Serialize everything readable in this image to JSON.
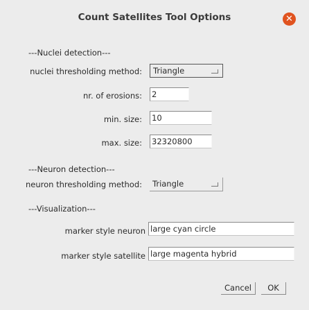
{
  "window": {
    "title": "Count Satellites Tool Options",
    "close_icon": "close-icon",
    "close_glyph": "✕",
    "accent": "#e0531f"
  },
  "nuclei": {
    "header": "---Nuclei detection---",
    "threshold_label": "nuclei thresholding method:",
    "threshold_value": "Triangle",
    "erosions_label": "nr. of erosions:",
    "erosions_value": "2",
    "min_size_label": "min. size:",
    "min_size_value": "10",
    "max_size_label": "max. size:",
    "max_size_value": "32320800"
  },
  "neuron": {
    "header": "---Neuron detection---",
    "threshold_label": "neuron thresholding method:",
    "threshold_value": "Triangle"
  },
  "visualization": {
    "header": "---Visualization---",
    "marker_neuron_label": "marker style neuron",
    "marker_neuron_value": "large cyan circle",
    "marker_satellite_label": "marker style satellite",
    "marker_satellite_value": "large magenta hybrid"
  },
  "buttons": {
    "cancel": "Cancel",
    "ok": "OK"
  }
}
